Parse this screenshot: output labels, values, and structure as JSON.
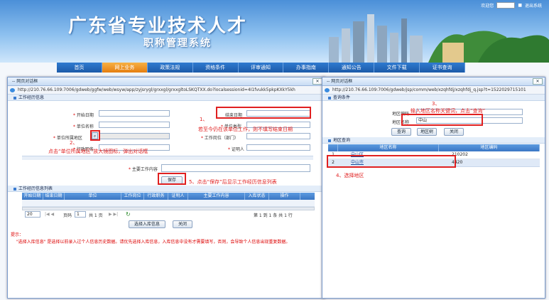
{
  "header": {
    "title_main": "广东省专业技术人才",
    "title_sub": "职称管理系统",
    "user_label": "欢迎您",
    "logout": "退出系统"
  },
  "nav": {
    "items": [
      "首页",
      "网上业务",
      "政策法规",
      "资格条件",
      "评审通知",
      "办事指南",
      "通知公告",
      "文件下载",
      "证书查询"
    ],
    "active_index": 1
  },
  "left_window": {
    "title": "-- 网页对话框",
    "address": "http://210.76.66.109:7006/gdweb/ggfw/web/wsyw/app/zyjsrygl/grxxgl/grxxgltoLSKQTXX.do?localsessionid=4I1fvukk5pkpKXkY5kh",
    "section_work": "工作经历信息",
    "labels": {
      "start_date": "开始日期",
      "end_date": "结束日期",
      "unit_name": "单位名称",
      "unit_type": "单位类型",
      "unit_region": "单位所属地区",
      "post": "工作岗位（部门）",
      "admin_post": "行政职务",
      "witness": "证明人",
      "content": "主要工作内容"
    },
    "save_button": "保存",
    "section_list": "工作经历信息列表",
    "table_columns": [
      "开始日期",
      "结束日期",
      "单位",
      "工作岗位",
      "行政职务",
      "证明人",
      "主要工作内容",
      "入库状态",
      "操作"
    ],
    "pager": {
      "page_size": "20",
      "page_label": "页码",
      "page_value": "1",
      "total": "共 1 页",
      "summary": "第 1 到 1 条 共 1 行"
    },
    "select_button": "选择入库信息",
    "close_button": "关闭",
    "tip_title": "提示：",
    "tip_text": "\"选择入库信息\" 是选择以前录入过个人信息历史数据。请优先选择入库信息，入库信息中没有才需要填写，否则，会导致个人信息出现重复数据。"
  },
  "right_window": {
    "title": "-- 网页对话框",
    "address": "http://210.76.66.109:7006/gdweb/jsp/comm/web/xzqhfdj/xzqhfdj_q.jsp?t=1522029715101",
    "section_query": "查询条件",
    "code_label": "地区编码",
    "name_label": "地区名称",
    "name_value": "中山",
    "buttons": [
      "查询",
      "地区树",
      "关闭"
    ],
    "section_result": "地区查询",
    "columns": [
      "地区名称",
      "地区编码"
    ],
    "rows": [
      {
        "idx": "1",
        "name": "中山区",
        "code": "210202"
      },
      {
        "idx": "2",
        "name": "中山市",
        "code": "4420"
      }
    ]
  },
  "annotations": {
    "a1": "1、",
    "a1b": "若至今仍在该单位工作，则不填写结束日期",
    "a2": "2、",
    "a2b": "点击“单位所属地区”放大镜图标，弹出对话框",
    "a3": "3、",
    "a3b": "输入地区名称关键词，点击“查询”",
    "a4": "4、选择地区",
    "a5": "5、点击“保存”后显示工作经历信息列表"
  }
}
